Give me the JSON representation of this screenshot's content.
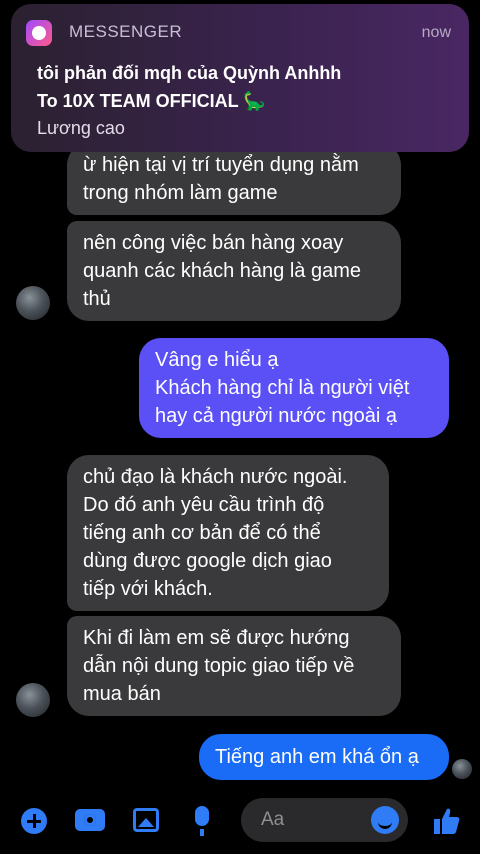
{
  "notification": {
    "app_name": "MESSENGER",
    "time": "now",
    "title_line1": "tôi phản đối mqh của Quỳnh Anhhh",
    "title_line2": "To 10X TEAM OFFICIAL 🦕",
    "body": "Lương cao"
  },
  "messages": [
    {
      "side": "in",
      "lines": [
        "ừ hiện tại vị trí tuyển dụng nằm",
        "trong nhóm làm game"
      ]
    },
    {
      "side": "in",
      "lines": [
        "nên công việc bán hàng xoay",
        "quanh các khách hàng là game",
        "thủ"
      ]
    },
    {
      "side": "out",
      "lines": [
        "Vâng e hiểu ạ",
        "Khách hàng chỉ là người việt",
        "hay cả người nước ngoài ạ"
      ]
    },
    {
      "side": "in",
      "lines": [
        "chủ đạo là khách nước ngoài.",
        "Do đó anh yêu cầu trình độ",
        "tiếng anh cơ bản để có thể",
        "dùng được google dịch giao",
        "tiếp với khách."
      ]
    },
    {
      "side": "in",
      "lines": [
        "Khi đi làm em sẽ được hướng",
        "dẫn nội dung topic giao tiếp về",
        "mua bán"
      ]
    },
    {
      "side": "out",
      "lines": [
        "Tiếng anh em khá ổn ạ"
      ]
    }
  ],
  "composer": {
    "placeholder": "Aa"
  },
  "icons": {
    "add": "plus-circle-icon",
    "camera": "camera-icon",
    "gallery": "image-icon",
    "voice": "microphone-icon",
    "emoji": "emoji-icon",
    "like": "thumbs-up-icon"
  },
  "colors": {
    "incoming": "#3a3a3c",
    "outgoing_purple": "#5b50f6",
    "outgoing_blue": "#1a6cf6",
    "accent": "#2f7cf6"
  }
}
